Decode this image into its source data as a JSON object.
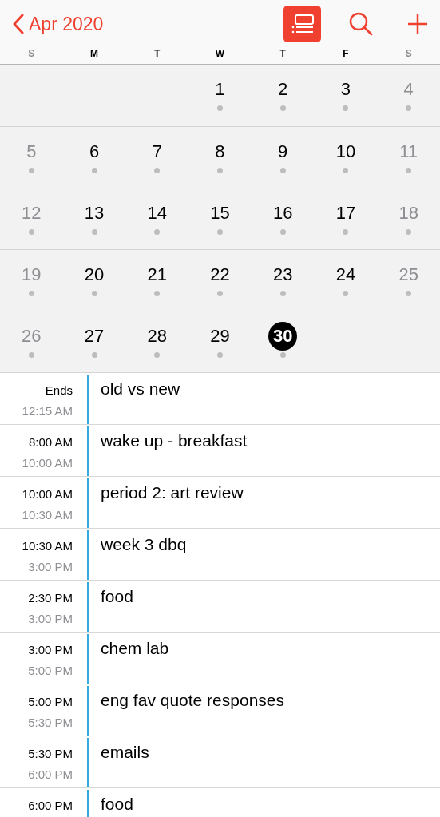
{
  "header": {
    "back_label": "Apr 2020",
    "list_view_selected": true
  },
  "weekdays": [
    {
      "label": "S",
      "weekend": true
    },
    {
      "label": "M",
      "weekend": false
    },
    {
      "label": "T",
      "weekend": false
    },
    {
      "label": "W",
      "weekend": false
    },
    {
      "label": "T",
      "weekend": false
    },
    {
      "label": "F",
      "weekend": false
    },
    {
      "label": "S",
      "weekend": true
    }
  ],
  "weeks": [
    [
      {
        "kind": "empty"
      },
      {
        "kind": "empty"
      },
      {
        "kind": "empty"
      },
      {
        "kind": "day",
        "day": "1",
        "weekend": false,
        "has_events": true,
        "selected": false
      },
      {
        "kind": "day",
        "day": "2",
        "weekend": false,
        "has_events": true,
        "selected": false
      },
      {
        "kind": "day",
        "day": "3",
        "weekend": false,
        "has_events": true,
        "selected": false
      },
      {
        "kind": "day",
        "day": "4",
        "weekend": true,
        "has_events": true,
        "selected": false
      }
    ],
    [
      {
        "kind": "day",
        "day": "5",
        "weekend": true,
        "has_events": true,
        "selected": false
      },
      {
        "kind": "day",
        "day": "6",
        "weekend": false,
        "has_events": true,
        "selected": false
      },
      {
        "kind": "day",
        "day": "7",
        "weekend": false,
        "has_events": true,
        "selected": false
      },
      {
        "kind": "day",
        "day": "8",
        "weekend": false,
        "has_events": true,
        "selected": false
      },
      {
        "kind": "day",
        "day": "9",
        "weekend": false,
        "has_events": true,
        "selected": false
      },
      {
        "kind": "day",
        "day": "10",
        "weekend": false,
        "has_events": true,
        "selected": false
      },
      {
        "kind": "day",
        "day": "11",
        "weekend": true,
        "has_events": true,
        "selected": false
      }
    ],
    [
      {
        "kind": "day",
        "day": "12",
        "weekend": true,
        "has_events": true,
        "selected": false
      },
      {
        "kind": "day",
        "day": "13",
        "weekend": false,
        "has_events": true,
        "selected": false
      },
      {
        "kind": "day",
        "day": "14",
        "weekend": false,
        "has_events": true,
        "selected": false
      },
      {
        "kind": "day",
        "day": "15",
        "weekend": false,
        "has_events": true,
        "selected": false
      },
      {
        "kind": "day",
        "day": "16",
        "weekend": false,
        "has_events": true,
        "selected": false
      },
      {
        "kind": "day",
        "day": "17",
        "weekend": false,
        "has_events": true,
        "selected": false
      },
      {
        "kind": "day",
        "day": "18",
        "weekend": true,
        "has_events": true,
        "selected": false
      }
    ],
    [
      {
        "kind": "day",
        "day": "19",
        "weekend": true,
        "has_events": true,
        "selected": false
      },
      {
        "kind": "day",
        "day": "20",
        "weekend": false,
        "has_events": true,
        "selected": false
      },
      {
        "kind": "day",
        "day": "21",
        "weekend": false,
        "has_events": true,
        "selected": false
      },
      {
        "kind": "day",
        "day": "22",
        "weekend": false,
        "has_events": true,
        "selected": false
      },
      {
        "kind": "day",
        "day": "23",
        "weekend": false,
        "has_events": true,
        "selected": false
      },
      {
        "kind": "day",
        "day": "24",
        "weekend": false,
        "has_events": true,
        "selected": false
      },
      {
        "kind": "day",
        "day": "25",
        "weekend": true,
        "has_events": true,
        "selected": false
      }
    ],
    [
      {
        "kind": "day",
        "day": "26",
        "weekend": true,
        "has_events": true,
        "selected": false
      },
      {
        "kind": "day",
        "day": "27",
        "weekend": false,
        "has_events": true,
        "selected": false
      },
      {
        "kind": "day",
        "day": "28",
        "weekend": false,
        "has_events": true,
        "selected": false
      },
      {
        "kind": "day",
        "day": "29",
        "weekend": false,
        "has_events": true,
        "selected": false
      },
      {
        "kind": "day",
        "day": "30",
        "weekend": false,
        "has_events": true,
        "selected": true
      },
      {
        "kind": "empty"
      },
      {
        "kind": "empty"
      }
    ]
  ],
  "events": [
    {
      "start": "Ends",
      "end": "12:15 AM",
      "title": "old vs new"
    },
    {
      "start": "8:00 AM",
      "end": "10:00 AM",
      "title": "wake up - breakfast"
    },
    {
      "start": "10:00 AM",
      "end": "10:30 AM",
      "title": "period 2: art review"
    },
    {
      "start": "10:30 AM",
      "end": "3:00 PM",
      "title": "week 3 dbq"
    },
    {
      "start": "2:30 PM",
      "end": "3:00 PM",
      "title": "food"
    },
    {
      "start": "3:00 PM",
      "end": "5:00 PM",
      "title": "chem lab"
    },
    {
      "start": "5:00 PM",
      "end": "5:30 PM",
      "title": "eng fav quote responses"
    },
    {
      "start": "5:30 PM",
      "end": "6:00 PM",
      "title": "emails"
    },
    {
      "start": "6:00 PM",
      "title": "food"
    }
  ]
}
